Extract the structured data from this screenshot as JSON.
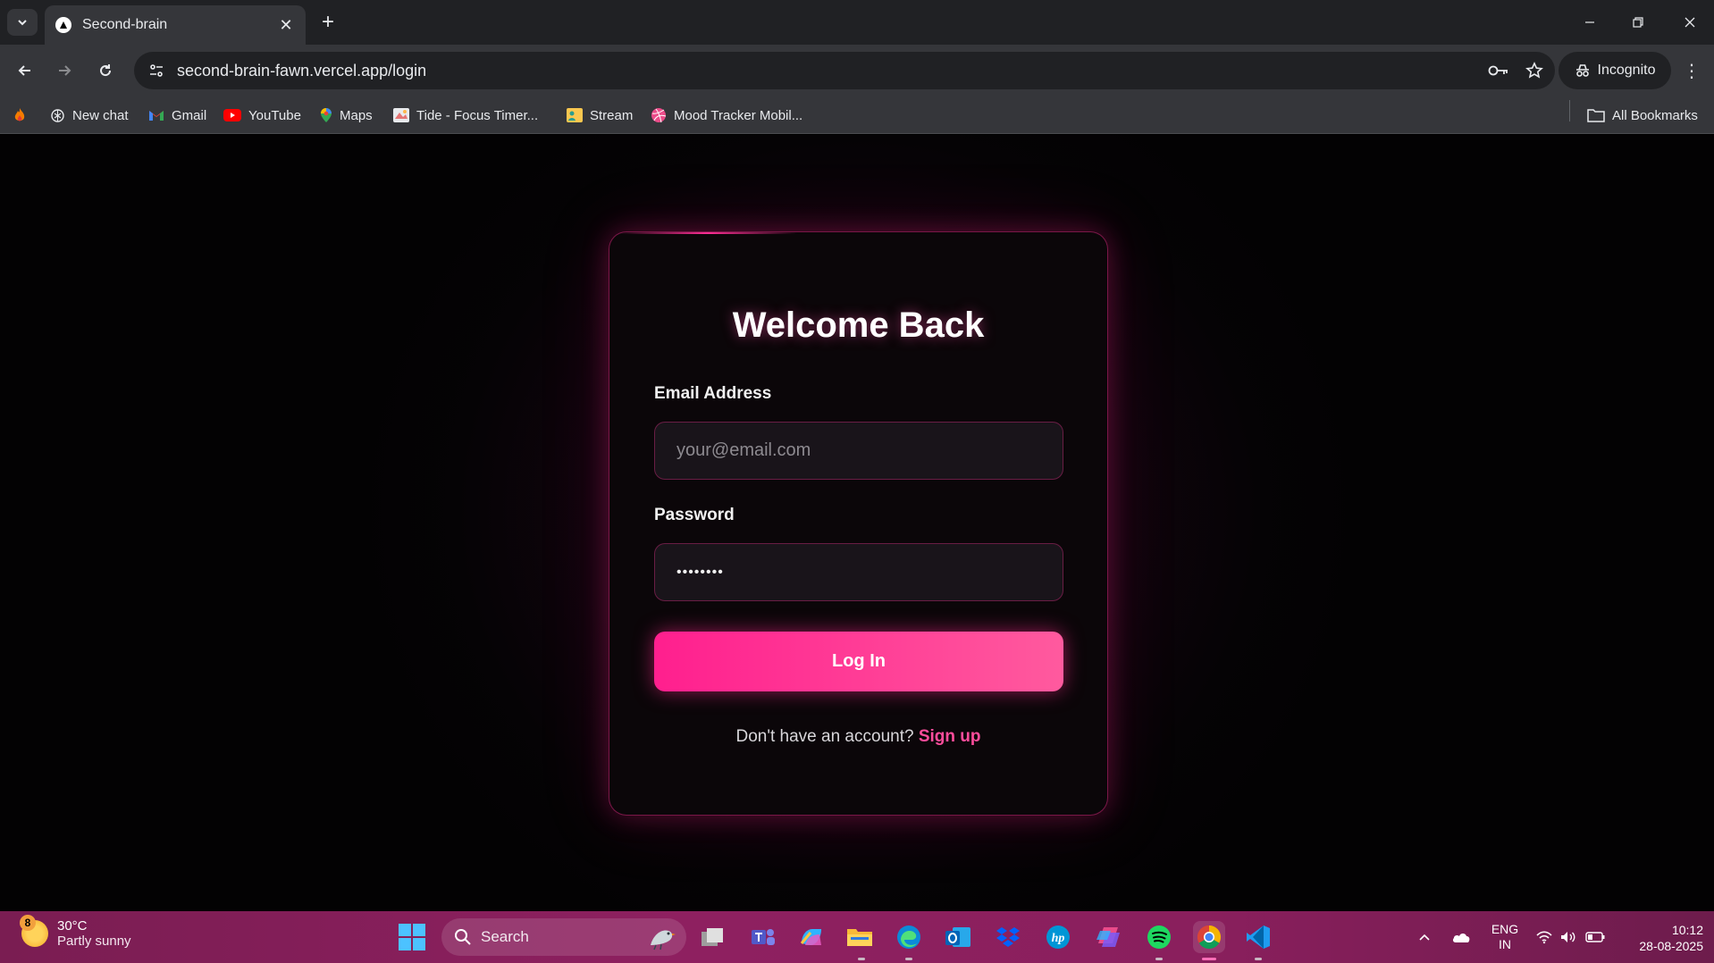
{
  "browser": {
    "tab_title": "Second-brain",
    "url": "second-brain-fawn.vercel.app/login",
    "incognito_label": "Incognito",
    "bookmarks": [
      {
        "label": "",
        "icon": "flame-icon"
      },
      {
        "label": "New chat",
        "icon": "openai-icon"
      },
      {
        "label": "Gmail",
        "icon": "gmail-icon"
      },
      {
        "label": "YouTube",
        "icon": "youtube-icon"
      },
      {
        "label": "Maps",
        "icon": "maps-icon"
      },
      {
        "label": "Tide - Focus Timer...",
        "icon": "tide-icon"
      },
      {
        "label": "Stream",
        "icon": "stream-icon"
      },
      {
        "label": "Mood Tracker Mobil...",
        "icon": "dribbble-icon"
      }
    ],
    "all_bookmarks_label": "All Bookmarks"
  },
  "login": {
    "title": "Welcome Back",
    "email_label": "Email Address",
    "email_placeholder": "your@email.com",
    "password_label": "Password",
    "password_value": "••••••••",
    "login_button": "Log In",
    "signup_prompt": "Don't have an account?",
    "signup_link": "Sign up"
  },
  "taskbar": {
    "weather_badge": "8",
    "weather_temp": "30°C",
    "weather_desc": "Partly sunny",
    "search_label": "Search",
    "lang_line1": "ENG",
    "lang_line2": "IN",
    "time": "10:12",
    "date": "28-08-2025",
    "apps": [
      "task-view",
      "teams",
      "copilot",
      "file-explorer",
      "edge",
      "outlook",
      "dropbox",
      "hp",
      "m365",
      "spotify",
      "chrome",
      "vscode"
    ]
  },
  "colors": {
    "accent": "#ff2d95",
    "button_start": "#ff1f8e",
    "button_end": "#ff5a9e",
    "link": "#ff4d9c",
    "taskbar": "#8a1f5d"
  }
}
